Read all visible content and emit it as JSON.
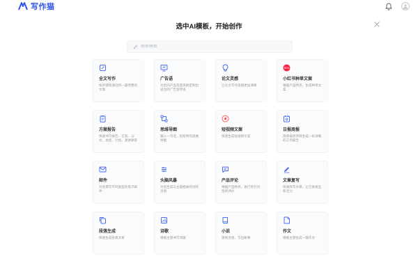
{
  "app": {
    "logo_text": "写作猫",
    "brand_color": "#2f54eb"
  },
  "header": {
    "icons": [
      "bell-icon",
      "user-avatar-icon"
    ]
  },
  "panel": {
    "title": "选中AI模板，开始创作",
    "close_icon": "close-icon"
  },
  "search": {
    "placeholder": "搜索模板"
  },
  "templates": [
    {
      "title": "全文写作",
      "desc": "按步骤快速创作一篇完整的文章",
      "icon": "edit-icon",
      "color": "#4a6cf7"
    },
    {
      "title": "广告语",
      "desc": "为您的产品及其风格定制出适合的广告宣传语",
      "icon": "monitor-icon",
      "color": "#4a6cf7"
    },
    {
      "title": "论文灵感",
      "desc": "让论文写作思路更加清晰",
      "icon": "lightbulb-icon",
      "color": "#4a6cf7"
    },
    {
      "title": "小红书种草文案",
      "desc": "根据产品特点，生成种草文案",
      "icon": "red-book-icon",
      "color": "#ff2442"
    },
    {
      "title": "方案报告",
      "desc": "快速书写报告、方案、公文、总结、计划、演讲稿等",
      "icon": "clipboard-icon",
      "color": "#4a6cf7"
    },
    {
      "title": "思维导图",
      "desc": "输入一句话，轻松制作思维导图",
      "icon": "mindmap-icon",
      "color": "#4a6cf7"
    },
    {
      "title": "短视频文案",
      "desc": "快速生成短视频文案",
      "icon": "play-icon",
      "color": "#ff5a5f"
    },
    {
      "title": "日报周报",
      "desc": "简单描述项目生成一份详细的工作报告",
      "icon": "calendar-icon",
      "color": "#4a6cf7"
    },
    {
      "title": "邮件",
      "desc": "为您撰写不同类型的电子邮件",
      "icon": "mail-icon",
      "color": "#4a6cf7"
    },
    {
      "title": "头脑风暴",
      "desc": "为您生成与主题相关的创作灵感",
      "icon": "sliders-icon",
      "color": "#4a6cf7"
    },
    {
      "title": "产品评论",
      "desc": "根据产品特点，进行有针对性的评价",
      "icon": "comment-icon",
      "color": "#4a6cf7"
    },
    {
      "title": "文章复写",
      "desc": "快速改写文章，让它焕发全新活力",
      "icon": "pen-rewrite-icon",
      "color": "#4a6cf7"
    },
    {
      "title": "段落生成",
      "desc": "快速生成各类文章",
      "icon": "copy-icon",
      "color": "#4a6cf7"
    },
    {
      "title": "诗歌",
      "desc": "根据主题书写诗歌",
      "icon": "image-icon",
      "color": "#4a6cf7"
    },
    {
      "title": "小说",
      "desc": "激发灵感，写出故事",
      "icon": "book-icon",
      "color": "#4a6cf7"
    },
    {
      "title": "作文",
      "desc": "根据主题生成一篇作文",
      "icon": "document-icon",
      "color": "#4a6cf7"
    }
  ]
}
